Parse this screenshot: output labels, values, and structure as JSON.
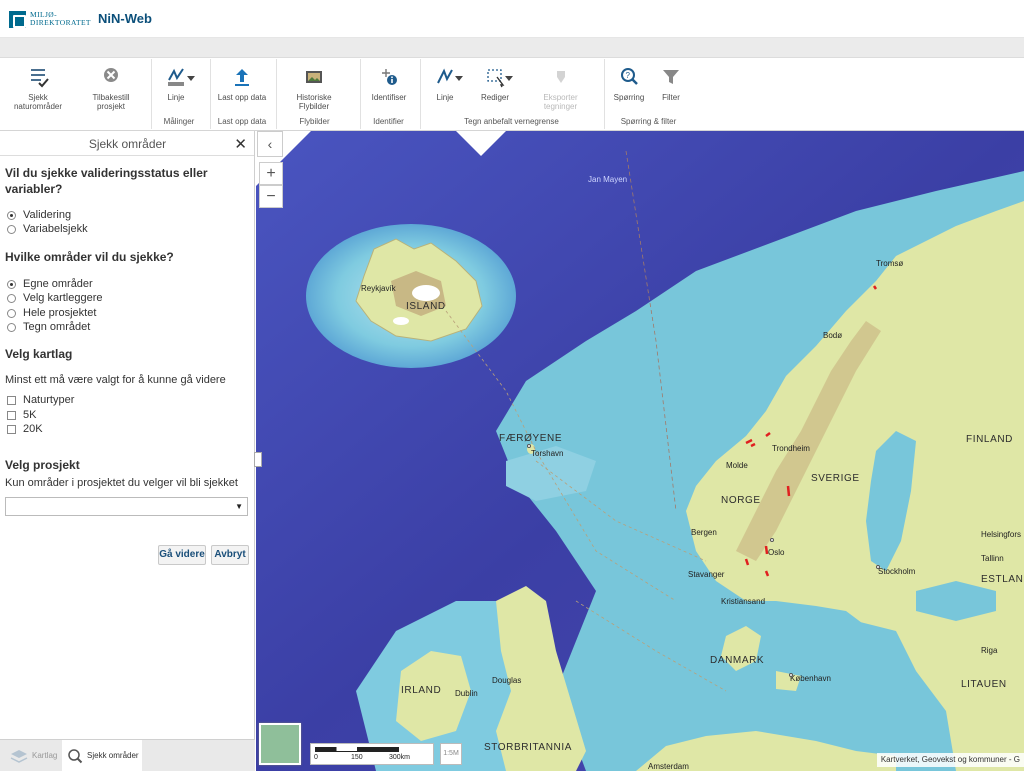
{
  "header": {
    "logo_line1": "MILJØ-",
    "logo_line2": "DIREKTORATET",
    "app_title": "NiN-Web"
  },
  "toolbar": {
    "items": [
      {
        "label1": "Sjekk",
        "label2": "naturområder",
        "icon": "check-list-icon"
      },
      {
        "label1": "Tilbakestill",
        "label2": "prosjekt",
        "icon": "close-circle-icon"
      },
      {
        "label1": "Linje",
        "label2": "",
        "icon": "measure-line-icon"
      },
      {
        "label1": "Last opp data",
        "label2": "",
        "icon": "upload-icon"
      },
      {
        "label1": "Historiske",
        "label2": "Flybilder",
        "icon": "photo-icon"
      },
      {
        "label1": "Identifiser",
        "label2": "",
        "icon": "identify-icon"
      },
      {
        "label1": "Linje",
        "label2": "",
        "icon": "draw-line-icon"
      },
      {
        "label1": "Rediger",
        "label2": "",
        "icon": "edit-icon"
      },
      {
        "label1": "Eksporter",
        "label2": "tegninger",
        "icon": "export-icon"
      },
      {
        "label1": "Spørring",
        "label2": "",
        "icon": "query-icon"
      },
      {
        "label1": "Filter",
        "label2": "",
        "icon": "filter-icon"
      }
    ],
    "groups": [
      "Målinger",
      "Last opp data",
      "Flybilder",
      "Identifier",
      "Tegn anbefalt vernegrense",
      "Spørring & filter"
    ]
  },
  "panel": {
    "title": "Sjekk områder",
    "q1_line1": "Vil du sjekke valideringsstatus eller",
    "q1_line2": "variabler?",
    "q1_options": [
      {
        "label": "Validering",
        "selected": true
      },
      {
        "label": "Variabelsjekk",
        "selected": false
      }
    ],
    "q2": "Hvilke områder vil du sjekke?",
    "q2_options": [
      {
        "label": "Egne områder",
        "selected": true
      },
      {
        "label": "Velg kartleggere",
        "selected": false
      },
      {
        "label": "Hele prosjektet",
        "selected": false
      },
      {
        "label": "Tegn området",
        "selected": false
      }
    ],
    "q3": "Velg kartlag",
    "q3_note": "Minst ett må være valgt for å kunne gå videre",
    "q3_options": [
      {
        "label": "Naturtyper",
        "checked": false
      },
      {
        "label": "5K",
        "checked": false
      },
      {
        "label": "20K",
        "checked": false
      }
    ],
    "q4": "Velg prosjekt",
    "q4_note": "Kun områder i prosjektet du velger vil bli sjekket",
    "select_value": "",
    "next_label": "Gå videre",
    "cancel_label": "Avbryt"
  },
  "bottom_tabs": [
    {
      "label": "Kartlag",
      "active": false,
      "icon": "layers-icon"
    },
    {
      "label": "Sjekk områder",
      "active": true,
      "icon": "search-icon"
    }
  ],
  "map": {
    "labels": {
      "reykjavik": "Reykjavík",
      "island": "ISLAND",
      "jan_mayen": "Jan Mayen",
      "faeroyene": "FÆRØYENE",
      "torshavn": "Torshavn",
      "tromso": "Tromsø",
      "bodo": "Bodø",
      "trondheim": "Trondheim",
      "molde": "Molde",
      "norge": "NORGE",
      "sverige": "SVERIGE",
      "finland": "FINLAND",
      "bergen": "Bergen",
      "oslo": "Oslo",
      "stavanger": "Stavanger",
      "kristiansand": "Kristiansand",
      "stockholm": "Stockholm",
      "helsingfors": "Helsingfors",
      "tallinn": "Tallinn",
      "estland": "ESTLAND",
      "riga": "Riga",
      "danmark": "DANMARK",
      "kobenhavn": "København",
      "litauen": "LITAUEN",
      "irland": "IRLAND",
      "dublin": "Dublin",
      "douglas": "Douglas",
      "storbritannia": "STORBRITANNIA",
      "amsterdam": "Amsterdam"
    },
    "scale": [
      "0",
      "150",
      "300km"
    ],
    "scale_box": "1:5M",
    "attribution": "Kartverket, Geovekst og kommuner - G",
    "colors": {
      "deep_sea": "#3a3fa8",
      "shelf_sea": "#72c4d8",
      "land": "#dfe7a6",
      "mountain": "#c7b784"
    }
  }
}
